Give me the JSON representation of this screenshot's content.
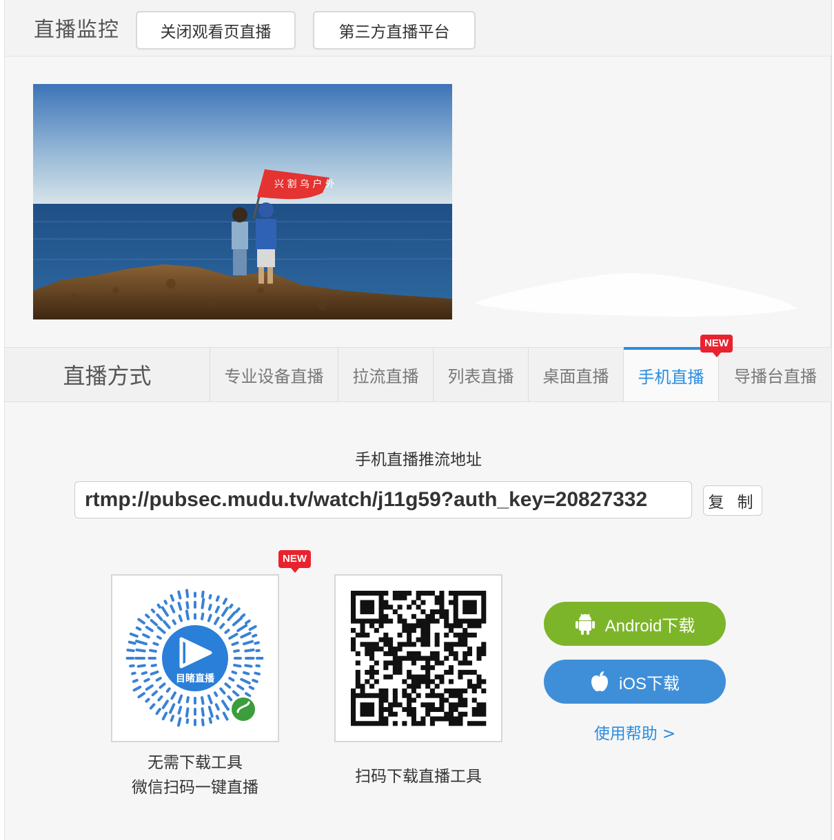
{
  "header": {
    "title": "直播监控",
    "buttons": [
      "关闭观看页直播",
      "第三方直播平台"
    ]
  },
  "preview": {
    "flag_text": "兴 割 乌 户 外"
  },
  "live_mode": {
    "title": "直播方式",
    "tabs": [
      {
        "label": "专业设备直播"
      },
      {
        "label": "拉流直播"
      },
      {
        "label": "列表直播"
      },
      {
        "label": "桌面直播"
      },
      {
        "label": "手机直播",
        "badge": "NEW"
      },
      {
        "label": "导播台直播"
      }
    ],
    "active_tab": "手机直播"
  },
  "mobile": {
    "push_label": "手机直播推流地址",
    "push_url": "rtmp://pubsec.mudu.tv/watch/j11g59?auth_key=20827332",
    "copy_label": "复 制",
    "mini_program": {
      "badge": "NEW",
      "logo_text": "目睹直播",
      "caption_line1": "无需下载工具",
      "caption_line2": "微信扫码一键直播"
    },
    "app_qr_caption": "扫码下载直播工具",
    "android_label": "Android下载",
    "ios_label": "iOS下载",
    "help_label": "使用帮助 >"
  },
  "colors": {
    "accent": "#2a8de0",
    "android": "#7db52a",
    "ios": "#3f8fd8",
    "badge": "#e8232f"
  },
  "icons": [
    "android-icon",
    "apple-icon",
    "play-icon",
    "wechat-mini-program-icon"
  ]
}
